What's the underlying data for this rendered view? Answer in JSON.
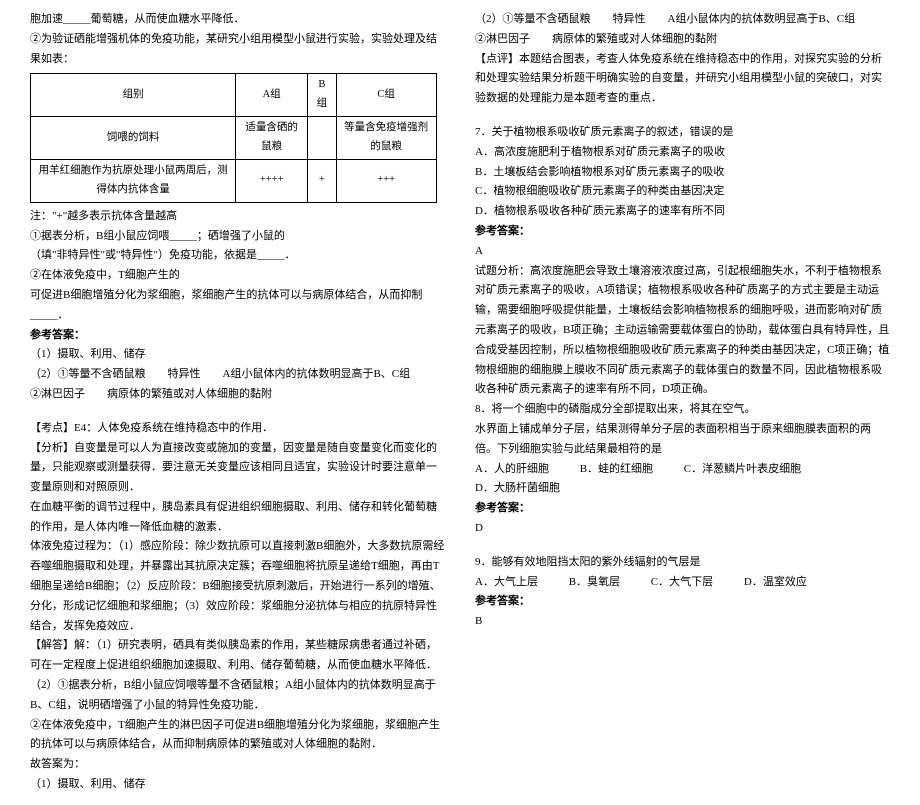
{
  "left": {
    "l1": "胞加速_____葡萄糖，从而使血糖水平降低．",
    "l2": "②为验证硒能增强机体的免疫功能，某研究小组用模型小鼠进行实验，实验处理及结果如表：",
    "table": {
      "h1": "组别",
      "h2": "A组",
      "h3": "B组",
      "h4": "C组",
      "r1c1": "饲喂的饲料",
      "r1c2": "适量含硒的鼠粮",
      "r1c3": "",
      "r1c4": "等量含免疫增强剂的鼠粮",
      "r2c1": "用羊红细胞作为抗原处理小鼠两周后，测得体内抗体含量",
      "r2c2": "++++",
      "r2c3": "+",
      "r2c4": "+++"
    },
    "l3": "注：\"+\"越多表示抗体含量越高",
    "l4": "①据表分析，B组小鼠应饲喂_____；硒增强了小鼠的",
    "l5": "（填\"非特异性\"或\"特异性\"）免疫功能，依据是_____．",
    "l6": "②在体液免疫中，T细胞产生的",
    "l7": "可促进B细胞增殖分化为浆细胞，浆细胞产生的抗体可以与病原体结合，从而抑制_____．",
    "ansTitle": "参考答案：",
    "a1": "（1）摄取、利用、储存",
    "a2": "（2）①等量不含硒鼠粮　　特异性　　A组小鼠体内的抗体数明显高于B、C组",
    "a3": "②淋巴因子　　病原体的繁殖或对人体细胞的黏附",
    "kd": "【考点】E4：人体免疫系统在维持稳态中的作用．",
    "fx1": "【分析】自变量是可以人为直接改变或施加的变量，因变量是随自变量变化而变化的量，只能观察或测量获得．要注意无关变量应该相同且适宜，实验设计时要注意单一变量原则和对照原则．",
    "fx2": "在血糖平衡的调节过程中，胰岛素具有促进组织细胞摄取、利用、储存和转化葡萄糖的作用，是人体内唯一降低血糖的激素．",
    "fx3": "体液免疫过程为：（1）感应阶段：除少数抗原可以直接刺激B细胞外，大多数抗原需经吞噬细胞摄取和处理，并暴露出其抗原决定簇；吞噬细胞将抗原呈递给T细胞，再由T细胞呈递给B细胞；（2）反应阶段：B细胞接受抗原刺激后，开始进行一系列的增殖、分化，形成记忆细胞和浆细胞；（3）效应阶段：浆细胞分泌抗体与相应的抗原特异性结合，发挥免疫效应．",
    "jd1": "【解答】解：（1）研究表明，硒具有类似胰岛素的作用，某些糖尿病患者通过补硒，可在一定程度上促进组织细胞加速摄取、利用、储存葡萄糖，从而使血糖水平降低．",
    "jd2": "（2）①据表分析，B组小鼠应饲喂等量不含硒鼠粮；A组小鼠体内的抗体数明显高于B、C组，说明硒增强了小鼠的特异性免疫功能．",
    "jd3": "②在体液免疫中，T细胞产生的淋巴因子可促进B细胞增殖分化为浆细胞，浆细胞产生的抗体可以与病原体结合，从而抑制病原体的繁殖或对人体细胞的黏附．",
    "jd4": "故答案为：",
    "jd5": "（1）摄取、利用、储存"
  },
  "right": {
    "r1": "（2）①等量不含硒鼠粮　　特异性　　A组小鼠体内的抗体数明显高于B、C组",
    "r2": "②淋巴因子　　病原体的繁殖或对人体细胞的黏附",
    "dp": "【点评】本题结合图表，考查人体免疫系统在维持稳态中的作用，对探究实验的分析和处理实验结果分析题干明确实验的自变量，并研究小组用模型小鼠的突破口，对实验数据的处理能力是本题考查的重点．",
    "q7": "7．关于植物根系吸收矿质元素离子的叙述，错误的是",
    "q7a": "A．高浓度施肥利于植物根系对矿质元素离子的吸收",
    "q7b": "B．土壤板结会影响植物根系对矿质元素离子的吸收",
    "q7c": "C．植物根细胞吸收矿质元素离子的种类由基因决定",
    "q7d": "D．植物根系吸收各种矿质元素离子的速率有所不同",
    "ansTitle": "参考答案：",
    "a7": "A",
    "a7exp": "试题分析：高浓度施肥会导致土壤溶液浓度过高，引起根细胞失水，不利于植物根系对矿质元素离子的吸收，A项错误；植物根系吸收各种矿质离子的方式主要是主动运输，需要细胞呼吸提供能量，土壤板结会影响植物根系的细胞呼吸，进而影响对矿质元素离子的吸收，B项正确；主动运输需要载体蛋白的协助，载体蛋白具有特异性，且合成受基因控制，所以植物根细胞吸收矿质元素离子的种类由基因决定，C项正确；植物根细胞的细胞膜上膜收不同矿质元素离子的载体蛋白的数量不同，因此植物根系吸收各种矿质元素离子的速率有所不同，D项正确。",
    "q8": "8．将一个细胞中的磷脂成分全部提取出来，将其在空气。",
    "q8b": "水界面上铺成单分子层，结果测得单分子层的表面积相当于原来细胞膜表面积的两倍。下列细胞实验与此结果最相符的是",
    "q8opts": {
      "a": "A．人的肝细胞",
      "b": "B．蛙的红细胞",
      "c": "C．洋葱鳞片叶表皮细胞",
      "d": "D．大肠杆菌细胞"
    },
    "a8": "D",
    "q9": "9．能够有效地阻挡太阳的紫外线辐射的气层是",
    "q9opts": {
      "a": "A．大气上层",
      "b": "B．臭氧层",
      "c": "C．大气下层",
      "d": "D．温室效应"
    },
    "a9": "B"
  }
}
